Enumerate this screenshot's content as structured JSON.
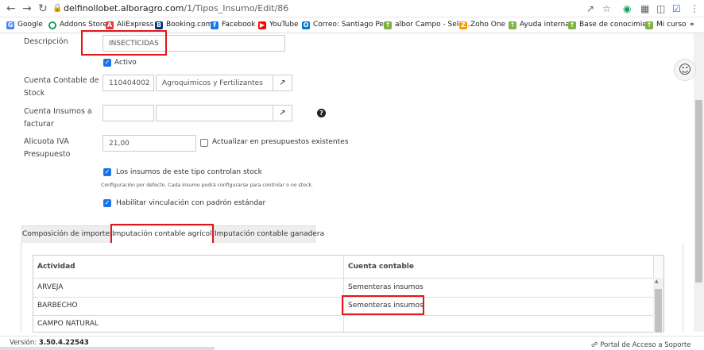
{
  "browser": {
    "url_host": "delfinollobet.alboragro.com",
    "url_path": "/1/Tipos_Insumo/Edit/86",
    "bookmarks": [
      "Google",
      "Addons Store",
      "AliExpress",
      "Booking.com",
      "Facebook",
      "YouTube",
      "Correo: Santiago Pe...",
      "albor Campo - Sele...",
      "Zoho One",
      "Ayuda interna",
      "Base de conocimie...",
      "Mi curso"
    ],
    "bookmark_colors": [
      "#4285f4",
      "#0f9d58",
      "#e53935",
      "#003580",
      "#1877f2",
      "#ff0000",
      "#0078d4",
      "#7cb342",
      "#ff9800",
      "#7cb342",
      "#7cb342",
      "#7cb342"
    ]
  },
  "form": {
    "descripcion_label": "Descripción",
    "descripcion_value": "INSECTICIDAS",
    "activo_label": "Activo",
    "cuenta_contable_label_1": "Cuenta Contable de",
    "cuenta_contable_label_2": "Stock",
    "cuenta_contable_code": "110404002",
    "cuenta_contable_name": "Agroquimicos y Fertilizantes",
    "cuenta_insumos_label_1": "Cuenta Insumos a",
    "cuenta_insumos_label_2": "facturar",
    "cuenta_insumos_code": "",
    "cuenta_insumos_name": "",
    "alicuota_label_1": "Alicuota IVA",
    "alicuota_label_2": "Presupuesto",
    "alicuota_value": "21,00",
    "actualizar_label": "Actualizar en presupuestos existentes",
    "controlan_stock_label": "Los insumos de este tipo controlan stock",
    "controlan_stock_note": "Configuración por defecto. Cada insumo podrá configurarse para controlar o no stock.",
    "habilitar_label": "Habilitar vinculación con padrón estándar"
  },
  "tabs": [
    {
      "label": "Composición de importes"
    },
    {
      "label": "Imputación contable agrícola"
    },
    {
      "label": "Imputación contable ganadera"
    }
  ],
  "table": {
    "headers": [
      "Actividad",
      "Cuenta contable"
    ],
    "rows": [
      {
        "actividad": "ARVEJA",
        "cuenta": "Sementeras insumos"
      },
      {
        "actividad": "BARBECHO",
        "cuenta": "Sementeras insumos"
      },
      {
        "actividad": "CAMPO NATURAL",
        "cuenta": ""
      }
    ]
  },
  "footer": {
    "version_label": "Versión:",
    "version_value": "3.50.4.22543",
    "support_label": "Portal de Acceso a Soporte"
  }
}
